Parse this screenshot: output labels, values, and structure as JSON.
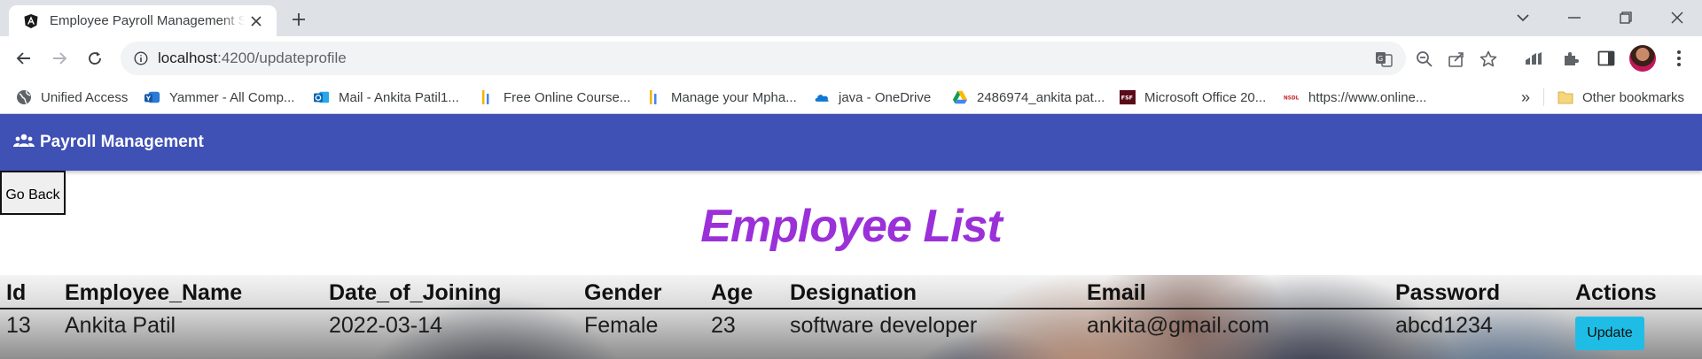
{
  "browser": {
    "tab_title": "Employee Payroll Management S",
    "url_host": "localhost",
    "url_path": ":4200/updateprofile"
  },
  "bookmarks": {
    "items": [
      {
        "label": "Unified Access",
        "icon": "globe-icon"
      },
      {
        "label": "Yammer - All Comp...",
        "icon": "yammer-icon"
      },
      {
        "label": "Mail - Ankita Patil1...",
        "icon": "outlook-icon"
      },
      {
        "label": "Free Online Course...",
        "icon": "bars-icon"
      },
      {
        "label": "Manage your Mpha...",
        "icon": "bars-icon"
      },
      {
        "label": "java - OneDrive",
        "icon": "onedrive-icon"
      },
      {
        "label": "2486974_ankita pat...",
        "icon": "drive-icon"
      },
      {
        "label": "Microsoft Office 20...",
        "icon": "fsf-icon"
      },
      {
        "label": "https://www.online...",
        "icon": "nsdl-icon"
      }
    ],
    "more": "»",
    "other_bookmarks": "Other bookmarks"
  },
  "app": {
    "title": "Payroll Management",
    "go_back_label": "Go Back",
    "heading": "Employee List"
  },
  "table": {
    "headers": [
      "Id",
      "Employee_Name",
      "Date_of_Joining",
      "Gender",
      "Age",
      "Designation",
      "Email",
      "Password",
      "Actions"
    ],
    "rows": [
      {
        "id": "13",
        "name": "Ankita Patil",
        "doj": "2022-03-14",
        "gender": "Female",
        "age": "23",
        "designation": "software developer",
        "email": "ankita@gmail.com",
        "password": "abcd1234",
        "action": "Update"
      }
    ]
  },
  "colors": {
    "appbar": "#3f51b5",
    "heading": "#9b30d9",
    "update_button": "#1fbde6"
  }
}
